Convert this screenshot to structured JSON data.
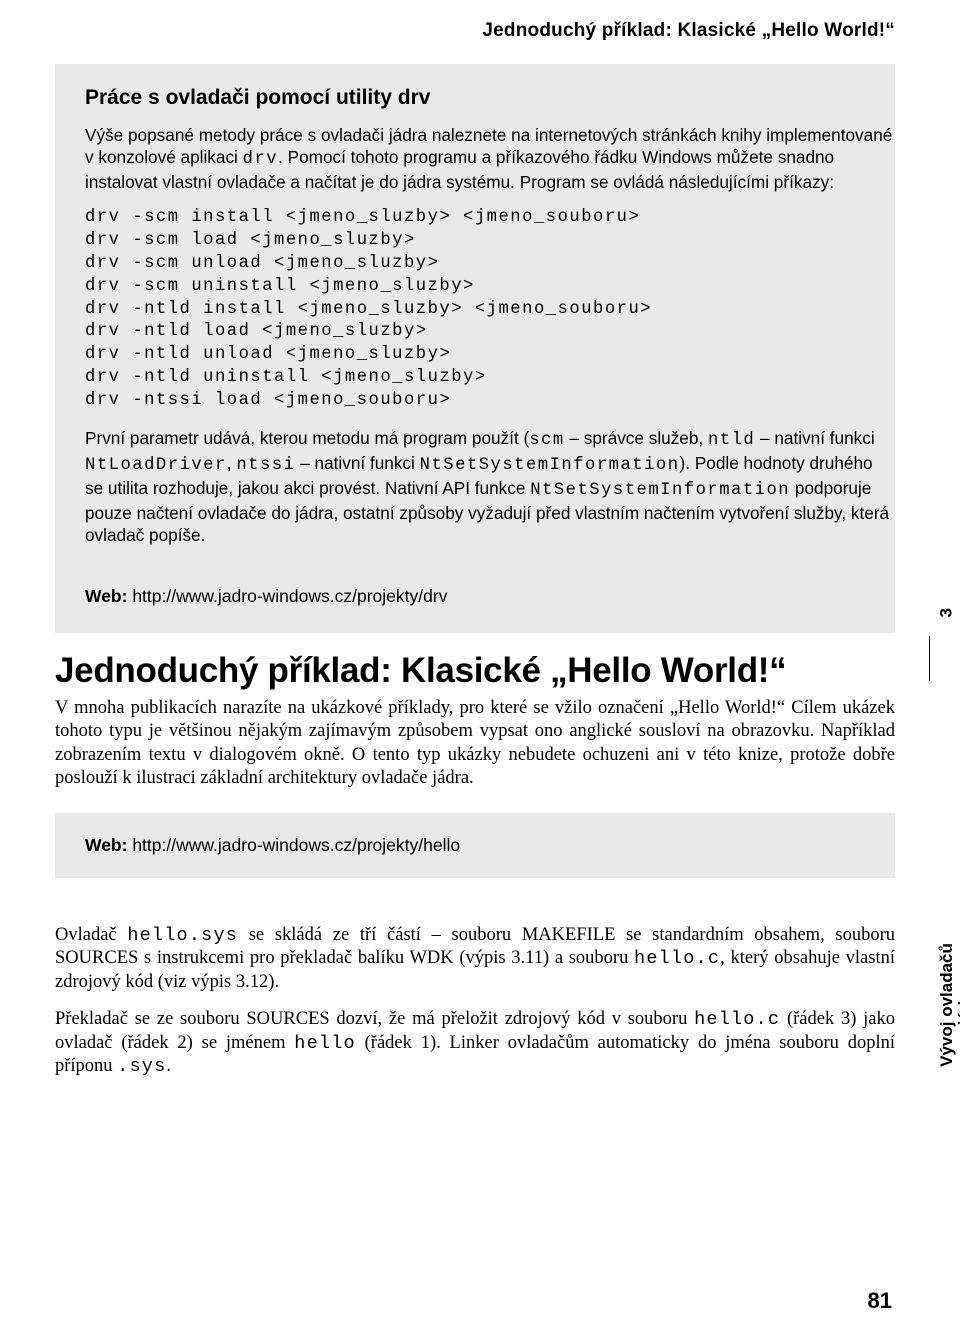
{
  "running_head": "Jednoduchý příklad: Klasické „Hello World!“",
  "box1": {
    "heading": "Práce s ovladači pomocí utility drv",
    "para1_a": "Výše popsané metody práce s ovladači jádra naleznete na internetových stránkách knihy imple­mentované v konzolové aplikaci ",
    "para1_drv": "drv",
    "para1_b": ". Pomocí tohoto programu a příkazového řádku Windows můžete snadno instalovat vlastní ovladače a načítat je do jádra systému. Program se ovládá násle­dujícími příkazy:",
    "code": "drv -scm install <jmeno_sluzby> <jmeno_souboru>\ndrv -scm load <jmeno_sluzby>\ndrv -scm unload <jmeno_sluzby>\ndrv -scm uninstall <jmeno_sluzby>\ndrv -ntld install <jmeno_sluzby> <jmeno_souboru>\ndrv -ntld load <jmeno_sluzby>\ndrv -ntld unload <jmeno_sluzby>\ndrv -ntld uninstall <jmeno_sluzby>\ndrv -ntssi load <jmeno_souboru>",
    "para2_a": "První parametr udává, kterou metodu má program použít (",
    "para2_scm": "scm",
    "para2_b": " – správce služeb, ",
    "para2_ntld": "ntld",
    "para2_c": " – nativní funkci ",
    "para2_ntload": "NtLoadDriver",
    "para2_d": ", ",
    "para2_ntssi": "ntssi",
    "para2_e": " – nativní funkci ",
    "para2_ntssi_fn": "NtSetSystemInformation",
    "para2_f": "). Podle hodnoty druhého se utilita rozhoduje, jakou akci provést. Nativní API funkce ",
    "para2_ntssi_fn2": "NtSetSystemInformation",
    "para2_g": " podporuje pou­ze načtení ovladače do jádra, ostatní způsoby vyžadují před vlastním načtením vytvoření služby, která ovladač popíše.",
    "web_label": "Web: ",
    "web_url": "http://www.jadro-windows.cz/projekty/drv"
  },
  "section": {
    "heading": "Jednoduchý příklad: Klasické „Hello World!“",
    "para": "V mnoha publikacích narazíte na ukázkové příklady, pro které se vžilo označení „Hello World!“ Cí­lem ukázek tohoto typu je většinou nějakým zajímavým způsobem vypsat ono anglické sousloví na obrazovku. Například zobrazením textu v dialogovém okně. O tento typ ukázky nebudete ochuzeni ani v této knize, protože dobře poslouží k ilustraci základní architektury ovladače jádra."
  },
  "box2": {
    "web_label": "Web: ",
    "web_url": "http://www.jadro-windows.cz/projekty/hello"
  },
  "serif": {
    "p1_a": "Ovladač ",
    "p1_hellosys": "hello.sys",
    "p1_b": " se skládá ze tří částí – souboru MAKEFILE se standardním obsahem, sou­boru SOURCES s instrukcemi pro překladač balíku WDK (výpis 3.11) a souboru ",
    "p1_helloc": "hello.c",
    "p1_c": ", kte­rý obsahuje vlastní zdrojový kód (viz výpis 3.12).",
    "p2_a": "Překladač se ze souboru SOURCES dozví, že má přeložit zdrojový kód v souboru ",
    "p2_helloc": "hello.c",
    "p2_b": " (řá­dek 3) jako ovladač (řádek 2) se jménem ",
    "p2_hello": "hello",
    "p2_c": " (řádek 1). Linker ovladačům automaticky do jména souboru doplní příponu ",
    "p2_sys": ".sys",
    "p2_d": "."
  },
  "sidebar": {
    "chapter_num": "3",
    "chapter_title": "Vývoj ovladačů jádra"
  },
  "page_number": "81"
}
